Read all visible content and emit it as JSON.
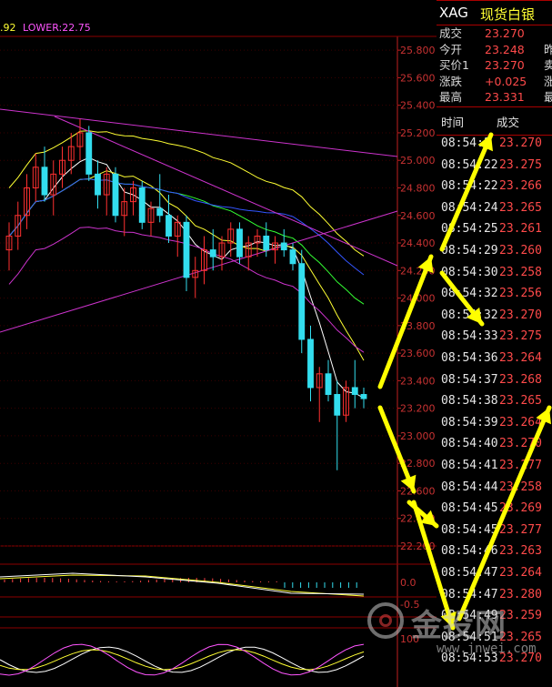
{
  "indicator_top": {
    "left_fragment": ".92",
    "lower_label": "LOWER:22.75"
  },
  "quote": {
    "symbol": "XAG",
    "name": "现货白银",
    "rows": [
      {
        "label": "成交",
        "value": "23.270",
        "color": "#ff4a4a",
        "extra": ""
      },
      {
        "label": "今开",
        "value": "23.248",
        "color": "#ff4a4a",
        "extra": "昨"
      },
      {
        "label": "买价1",
        "value": "23.270",
        "color": "#ff4a4a",
        "extra": "卖"
      },
      {
        "label": "涨跌",
        "value": "+0.025",
        "color": "#ff4a4a",
        "extra": "涨"
      },
      {
        "label": "最高",
        "value": "23.331",
        "color": "#ff4a4a",
        "extra": "最"
      }
    ]
  },
  "ticks": {
    "header_time": "时间",
    "header_price": "成交",
    "rows": [
      {
        "time": "08:54:2",
        "price": "23.270"
      },
      {
        "time": "08:54:22",
        "price": "23.275"
      },
      {
        "time": "08:54:22",
        "price": "23.266"
      },
      {
        "time": "08:54:24",
        "price": "23.265"
      },
      {
        "time": "08:54:25",
        "price": "23.261"
      },
      {
        "time": "08:54:29",
        "price": "23.260"
      },
      {
        "time": "08:54:30",
        "price": "23.258"
      },
      {
        "time": "08:54:32",
        "price": "23.256"
      },
      {
        "time": "08:54:32",
        "price": "23.270"
      },
      {
        "time": "08:54:33",
        "price": "23.275"
      },
      {
        "time": "08:54:36",
        "price": "23.264"
      },
      {
        "time": "08:54:37",
        "price": "23.268"
      },
      {
        "time": "08:54:38",
        "price": "23.265"
      },
      {
        "time": "08:54:39",
        "price": "23.264"
      },
      {
        "time": "08:54:40",
        "price": "23.270"
      },
      {
        "time": "08:54:41",
        "price": "23.277"
      },
      {
        "time": "08:54:44",
        "price": "23.258"
      },
      {
        "time": "08:54:45",
        "price": "23.269"
      },
      {
        "time": "08:54:45",
        "price": "23.277"
      },
      {
        "time": "08:54:46",
        "price": "23.263"
      },
      {
        "time": "08:54:47",
        "price": "23.264"
      },
      {
        "time": "08:54:47",
        "price": "23.280"
      },
      {
        "time": "08:54:49",
        "price": "23.259"
      },
      {
        "time": "08:54:51",
        "price": "23.265"
      },
      {
        "time": "08:54:53",
        "price": "23.270"
      }
    ]
  },
  "chart_data": {
    "type": "line",
    "title": "",
    "xlabel": "",
    "ylabel": "",
    "ylim": [
      22.2,
      25.9
    ],
    "price_ticks": [
      "25.800",
      "25.600",
      "25.400",
      "25.200",
      "25.000",
      "24.800",
      "24.600",
      "24.400",
      "24.200",
      "24.000",
      "23.800",
      "23.600",
      "23.400",
      "23.200",
      "23.000",
      "22.800",
      "22.600",
      "22.400",
      "22.200"
    ],
    "candles_ohlc": [
      [
        24.35,
        24.55,
        24.2,
        24.45
      ],
      [
        24.45,
        24.7,
        24.35,
        24.6
      ],
      [
        24.6,
        24.9,
        24.5,
        24.8
      ],
      [
        24.8,
        25.05,
        24.7,
        24.95
      ],
      [
        24.95,
        25.1,
        24.7,
        24.75
      ],
      [
        24.75,
        25.0,
        24.6,
        24.9
      ],
      [
        24.9,
        25.1,
        24.8,
        25.0
      ],
      [
        25.0,
        25.2,
        24.9,
        25.1
      ],
      [
        25.1,
        25.3,
        25.0,
        25.2
      ],
      [
        25.2,
        25.25,
        24.85,
        24.9
      ],
      [
        24.9,
        25.0,
        24.65,
        24.75
      ],
      [
        24.75,
        24.95,
        24.6,
        24.9
      ],
      [
        24.9,
        24.95,
        24.55,
        24.6
      ],
      [
        24.6,
        24.8,
        24.45,
        24.7
      ],
      [
        24.7,
        24.85,
        24.6,
        24.8
      ],
      [
        24.8,
        24.85,
        24.5,
        24.55
      ],
      [
        24.55,
        24.7,
        24.45,
        24.65
      ],
      [
        24.65,
        24.9,
        24.55,
        24.6
      ],
      [
        24.6,
        24.75,
        24.4,
        24.45
      ],
      [
        24.45,
        24.6,
        24.3,
        24.55
      ],
      [
        24.55,
        24.6,
        24.05,
        24.15
      ],
      [
        24.15,
        24.3,
        24.0,
        24.2
      ],
      [
        24.2,
        24.45,
        24.1,
        24.35
      ],
      [
        24.35,
        24.5,
        24.2,
        24.3
      ],
      [
        24.3,
        24.45,
        24.2,
        24.4
      ],
      [
        24.4,
        24.55,
        24.3,
        24.5
      ],
      [
        24.5,
        24.55,
        24.25,
        24.3
      ],
      [
        24.3,
        24.45,
        24.2,
        24.4
      ],
      [
        24.4,
        24.5,
        24.3,
        24.45
      ],
      [
        24.45,
        24.55,
        24.3,
        24.35
      ],
      [
        24.35,
        24.45,
        24.25,
        24.4
      ],
      [
        24.4,
        24.5,
        24.3,
        24.35
      ],
      [
        24.35,
        24.4,
        24.2,
        24.25
      ],
      [
        24.25,
        24.35,
        23.6,
        23.7
      ],
      [
        23.7,
        23.8,
        23.25,
        23.35
      ],
      [
        23.35,
        23.5,
        23.1,
        23.45
      ],
      [
        23.45,
        23.55,
        23.25,
        23.3
      ],
      [
        23.3,
        23.4,
        22.75,
        23.15
      ],
      [
        23.15,
        23.4,
        23.1,
        23.35
      ],
      [
        23.35,
        23.55,
        23.2,
        23.3
      ],
      [
        23.3,
        23.35,
        23.2,
        23.27
      ]
    ],
    "series": [
      {
        "name": "",
        "color": "#ffffff"
      },
      {
        "name": "",
        "color": "#ffff33"
      },
      {
        "name": "",
        "color": "#33ff33"
      },
      {
        "name": "",
        "color": "#3355ff"
      },
      {
        "name": "",
        "color": "#cc33cc"
      }
    ],
    "lower_label": "LOWER:22.75",
    "macd_ticks": [
      "0.0",
      "-0.5"
    ],
    "kdj_ticks": [
      "100"
    ],
    "colors": {
      "up": "#ff3030",
      "down": "#33ddee",
      "grid": "#8b0000",
      "axis_text": "#c83232"
    }
  },
  "watermark": {
    "brand": "金投网",
    "url": "www.jnwei.com"
  }
}
